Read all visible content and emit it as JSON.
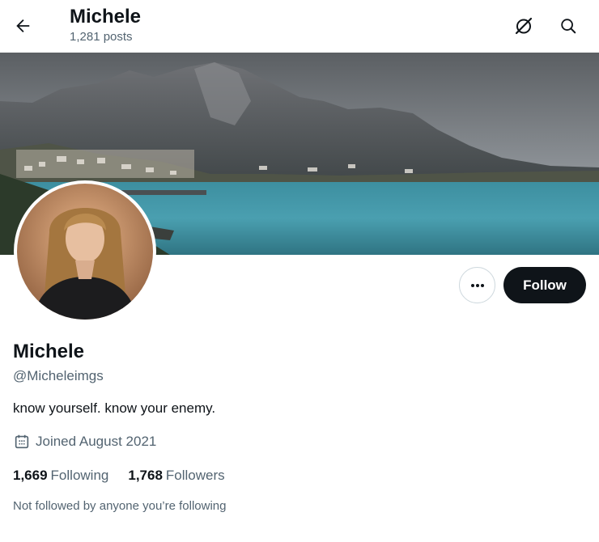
{
  "header": {
    "title": "Michele",
    "post_count": "1,281 posts",
    "back_icon": "arrow-left-icon",
    "grok_icon": "grok-icon",
    "search_icon": "search-icon"
  },
  "profile": {
    "name": "Michele",
    "handle": "@Micheleimgs",
    "bio": "know yourself. know your enemy.",
    "joined": "Joined August 2021",
    "following_count": "1,669",
    "following_label": "Following",
    "followers_count": "1,768",
    "followers_label": "Followers",
    "not_followed_note": "Not followed by anyone you’re following"
  },
  "actions": {
    "more_icon": "more-dots-icon",
    "follow_label": "Follow"
  },
  "colors": {
    "text_primary": "#0f1419",
    "text_secondary": "#536471",
    "follow_button_bg": "#0f1419"
  }
}
